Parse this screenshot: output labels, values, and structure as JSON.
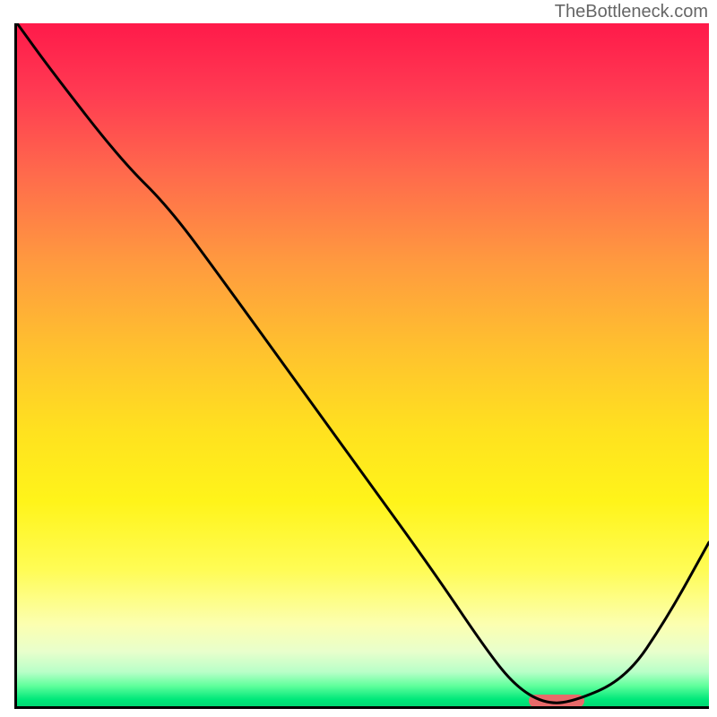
{
  "watermark": "TheBottleneck.com",
  "chart_data": {
    "type": "line",
    "title": "",
    "xlabel": "",
    "ylabel": "",
    "xlim": [
      0,
      100
    ],
    "ylim": [
      0,
      100
    ],
    "grid": false,
    "series": [
      {
        "name": "bottleneck-curve",
        "x": [
          0,
          5,
          15,
          22,
          30,
          40,
          50,
          60,
          68,
          72,
          76,
          80,
          88,
          94,
          100
        ],
        "values": [
          100,
          93,
          80,
          73,
          62,
          48,
          34,
          20,
          8,
          3,
          0.5,
          0.5,
          4,
          13,
          24
        ]
      }
    ],
    "marker": {
      "x_start": 74,
      "x_end": 82,
      "y": 0.8
    },
    "background_gradient": {
      "top": "#ff1a4a",
      "mid_upper": "#ffb030",
      "mid_lower": "#fff41a",
      "bottom": "#00d873"
    }
  }
}
